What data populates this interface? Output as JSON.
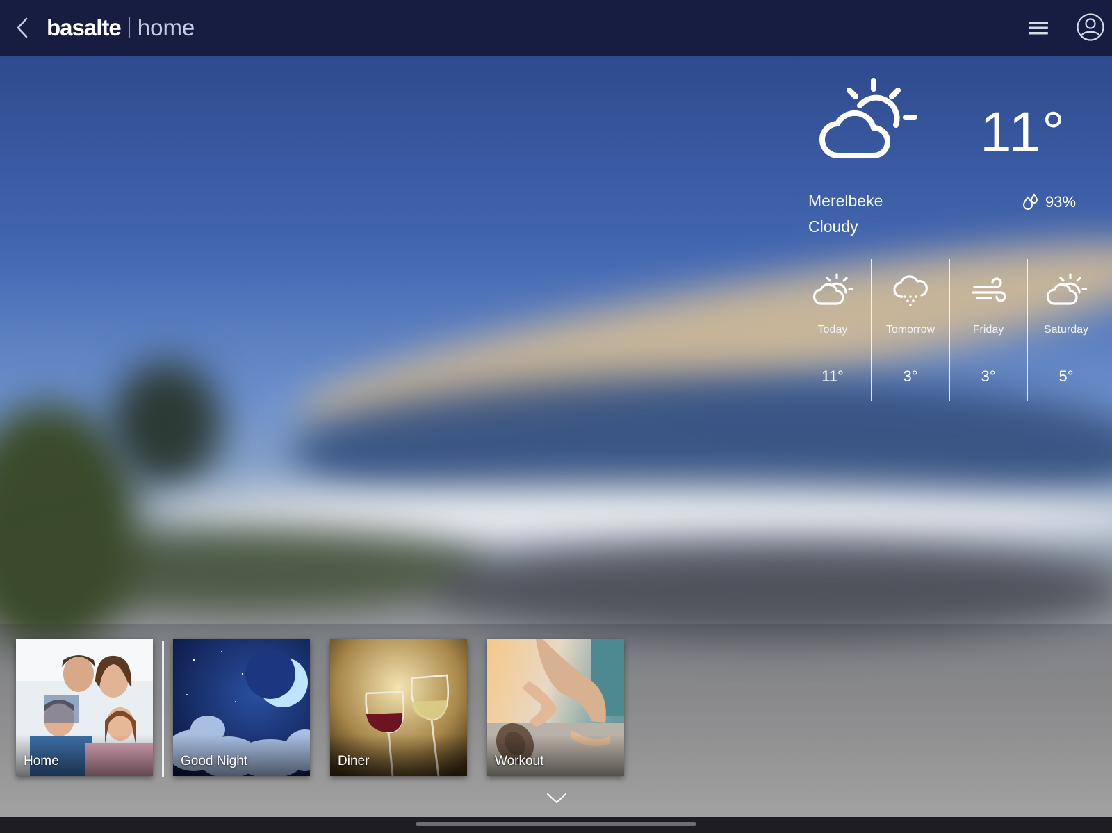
{
  "header": {
    "brand_name": "basalte",
    "section": "home",
    "icons": {
      "back": "chevron-left-icon",
      "menu": "hamburger-menu-icon",
      "user": "user-profile-icon"
    },
    "accent_color": "#e08a2a"
  },
  "weather": {
    "current_icon": "partly-cloudy-icon",
    "temperature": "11°",
    "location": "Merelbeke",
    "condition": "Cloudy",
    "humidity": "93%",
    "humidity_icon": "humidity-drops-icon",
    "forecast": [
      {
        "day": "Today",
        "temp": "11°",
        "icon": "partly-cloudy-icon"
      },
      {
        "day": "Tomorrow",
        "temp": "3°",
        "icon": "snow-cloud-icon"
      },
      {
        "day": "Friday",
        "temp": "3°",
        "icon": "wind-icon"
      },
      {
        "day": "Saturday",
        "temp": "5°",
        "icon": "partly-cloudy-icon"
      }
    ]
  },
  "scenes": [
    {
      "label": "Home",
      "icon": "family-photo"
    },
    {
      "label": "Good Night",
      "icon": "moon-clouds-photo"
    },
    {
      "label": "Diner",
      "icon": "wine-glasses-photo"
    },
    {
      "label": "Workout",
      "icon": "yoga-mat-photo"
    }
  ],
  "expand_icon": "chevron-down-icon"
}
